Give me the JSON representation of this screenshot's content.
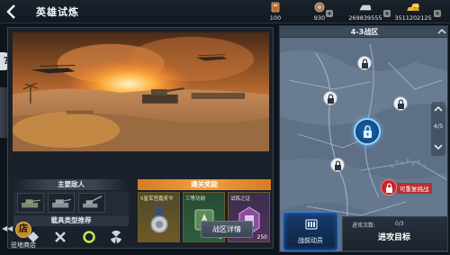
{
  "header": {
    "title": "英雄试炼",
    "resources": [
      {
        "name": "stamina",
        "icon": "stamina-icon",
        "value": "100"
      },
      {
        "name": "tokens",
        "icon": "medal-icon",
        "value": "930"
      },
      {
        "name": "silver",
        "icon": "silver-bar-icon",
        "value": "269839555"
      },
      {
        "name": "gold",
        "icon": "gold-bar-icon",
        "value": "3511202125"
      }
    ],
    "plus": "+"
  },
  "help": "?",
  "left_panel": {
    "enemies_title": "主要敌人",
    "rewards_title": "通关奖励",
    "vehicle_types_title": "载具类型推荐",
    "rewards": [
      {
        "title": "5星军官嘉奖令",
        "count": "",
        "color": "#6e5a26"
      },
      {
        "title": "三等功勋",
        "count": "5",
        "color": "#2f5e3c"
      },
      {
        "title": "试炼之证",
        "count": "250",
        "color": "#54305a"
      }
    ],
    "zone_details": "战区详情"
  },
  "shop": {
    "label": "驻地商店",
    "icon_glyph": "店",
    "arrows": "◀◀"
  },
  "map": {
    "zone_title": "4-3战区",
    "page_indicator": "4/5",
    "challenge_label": "可重复挑战"
  },
  "bottom": {
    "mobilize": "战前动员",
    "attack_count_label": "进攻次数:",
    "attack_count_value": "0/3",
    "attack_target": "进攻目标"
  },
  "colors": {
    "accent_orange": "#f0a040",
    "map_blue": "#1d6fb8",
    "challenge_red": "#c42626"
  }
}
